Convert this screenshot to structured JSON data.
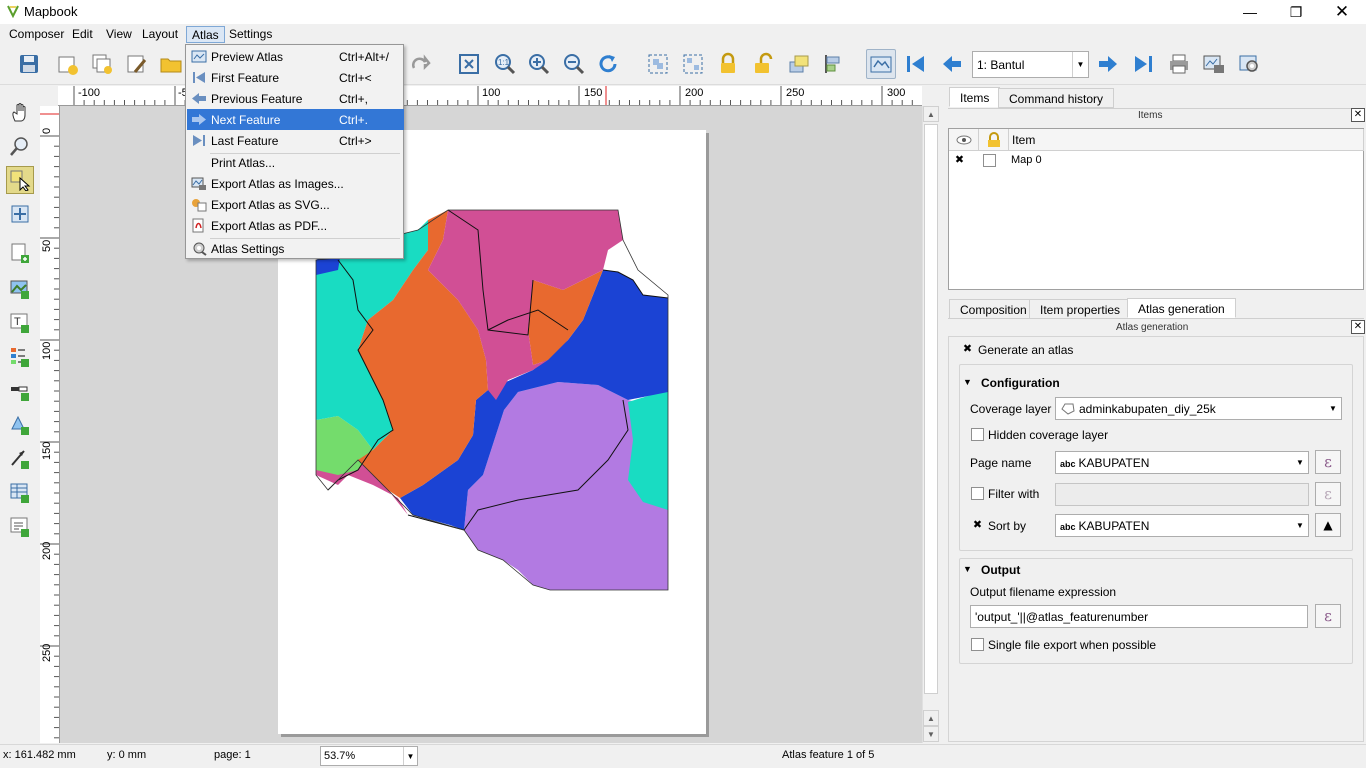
{
  "window": {
    "title": "Mapbook"
  },
  "menubar": {
    "items": [
      "Composer",
      "Edit",
      "View",
      "Layout",
      "Atlas",
      "Settings"
    ],
    "active": "Atlas"
  },
  "atlas_menu": {
    "items": [
      {
        "label": "Preview Atlas",
        "shortcut": "Ctrl+Alt+/",
        "icon": "preview-atlas-icon"
      },
      {
        "label": "First Feature",
        "shortcut": "Ctrl+<",
        "icon": "first-feature-icon"
      },
      {
        "label": "Previous Feature",
        "shortcut": "Ctrl+,",
        "icon": "previous-feature-icon"
      },
      {
        "label": "Next Feature",
        "shortcut": "Ctrl+.",
        "icon": "next-feature-icon",
        "highlighted": true
      },
      {
        "label": "Last Feature",
        "shortcut": "Ctrl+>",
        "icon": "last-feature-icon"
      },
      {
        "label": "Print Atlas...",
        "shortcut": "",
        "icon": "print-atlas-icon"
      },
      {
        "label": "Export Atlas as Images...",
        "shortcut": "",
        "icon": "export-images-icon"
      },
      {
        "label": "Export Atlas as SVG...",
        "shortcut": "",
        "icon": "export-svg-icon"
      },
      {
        "label": "Export Atlas as PDF...",
        "shortcut": "",
        "icon": "export-pdf-icon"
      },
      {
        "label": "Atlas Settings",
        "shortcut": "",
        "icon": "atlas-settings-icon"
      }
    ]
  },
  "toolbar": {
    "atlas_feature": "1: Bantul"
  },
  "rulers": {
    "horizontal": [
      "-100",
      "-5",
      "100",
      "150",
      "200",
      "250",
      "300"
    ],
    "vertical": [
      "0",
      "50",
      "100",
      "150",
      "200",
      "250"
    ]
  },
  "dock": {
    "top_tabs": [
      "Items",
      "Command history"
    ],
    "items_panel_title": "Items",
    "items_header": "Item",
    "items": [
      {
        "name": "Map 0",
        "visible": true,
        "locked": false
      }
    ],
    "bottom_tabs": [
      "Composition",
      "Item properties",
      "Atlas generation"
    ],
    "atlas_panel_title": "Atlas generation",
    "generate_atlas": {
      "label": "Generate an atlas",
      "checked": true
    },
    "configuration": {
      "title": "Configuration",
      "coverage_layer_label": "Coverage layer",
      "coverage_layer_value": "adminkabupaten_diy_25k",
      "hidden_coverage_label": "Hidden coverage layer",
      "hidden_coverage_checked": false,
      "page_name_label": "Page name",
      "page_name_value": "KABUPATEN",
      "filter_label": "Filter with",
      "filter_checked": false,
      "filter_value": "",
      "sort_label": "Sort by",
      "sort_checked": true,
      "sort_value": "KABUPATEN",
      "expr_symbol": "ε",
      "abc_tag": "abc"
    },
    "output": {
      "title": "Output",
      "filename_label": "Output filename expression",
      "filename_value": "'output_'||@atlas_featurenumber",
      "single_file_label": "Single file export when possible",
      "single_file_checked": false
    }
  },
  "statusbar": {
    "x": "x: 161.482 mm",
    "y": "y: 0 mm",
    "page": "page: 1",
    "zoom": "53.7%",
    "atlas_status": "Atlas feature 1 of 5"
  },
  "colors": {
    "teal": "#19dcc2",
    "orange": "#e8692f",
    "magenta": "#d14f95",
    "blue": "#1b43d4",
    "purple": "#b27ae2",
    "green": "#74dc6c",
    "highlight": "#3377d6"
  }
}
